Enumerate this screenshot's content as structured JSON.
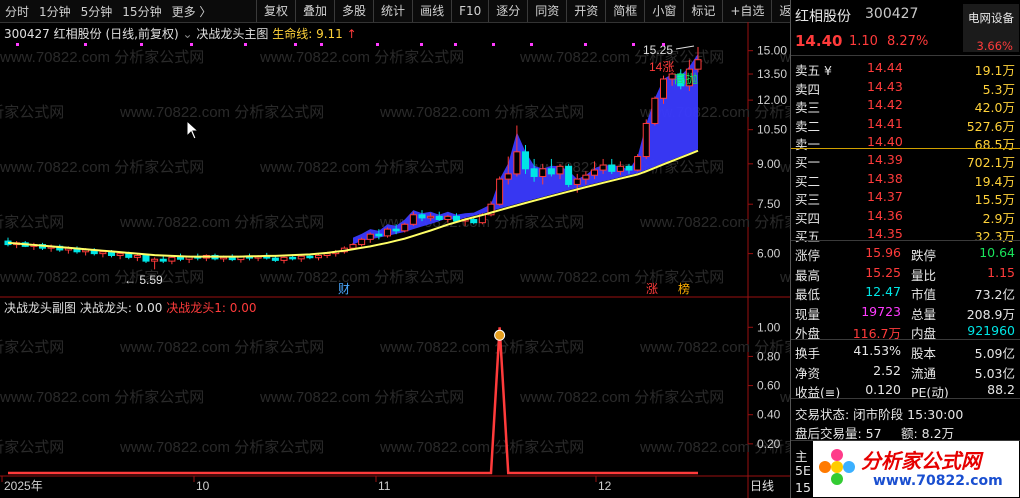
{
  "toolbar": {
    "period_items": [
      "分时",
      "1分钟",
      "5分钟",
      "15分钟",
      "更多 〉"
    ],
    "tools": [
      "复权",
      "叠加",
      "多股",
      "统计",
      "画线",
      "F10",
      "逐分",
      "同资",
      "开资",
      "简框",
      "小窗",
      "标记",
      "+自选",
      "返回"
    ]
  },
  "main_chart": {
    "code": "300427",
    "name": "红相股份",
    "mode": "(日线,前复权)",
    "formula": "决战龙头主图",
    "life_label": "生命线: 9.11",
    "life_arrow": "↑",
    "annotations": {
      "high_tag": "15.25",
      "low_tag": "5.59",
      "jump_tag": "14涨",
      "sell_tag": "高抛",
      "cai_tag": "财",
      "zhang_tag": "涨",
      "bang_tag": "榜"
    },
    "watermark": "www.70822.com 分析家公式网"
  },
  "sub_chart": {
    "formula": "决战龙头副图",
    "value_label": "决战龙头: 0.00",
    "value_label_red": "决战龙头1: 0.00"
  },
  "x_axis": {
    "labels": [
      "2025年",
      "10",
      "11",
      "12"
    ],
    "period_button": "日线"
  },
  "colors": {
    "up": "#ff3b3b",
    "down": "#00e6e6",
    "ma": "#ffff66",
    "band": "#3a3aff",
    "accent_red": "#ff3b3b"
  },
  "chart_data": [
    {
      "type": "candlestick",
      "title": "红相股份 (日线,前复权)",
      "y_ticks": [
        "15.00",
        "13.50",
        "12.00",
        "10.50",
        "9.00",
        "7.50",
        "6.00"
      ],
      "ylim": [
        5.0,
        15.6
      ],
      "y_scale": "log",
      "ohlc": [
        [
          6.35,
          6.45,
          6.2,
          6.25
        ],
        [
          6.25,
          6.35,
          6.15,
          6.3
        ],
        [
          6.3,
          6.35,
          6.18,
          6.2
        ],
        [
          6.2,
          6.3,
          6.1,
          6.25
        ],
        [
          6.25,
          6.3,
          6.1,
          6.15
        ],
        [
          6.15,
          6.25,
          6.05,
          6.2
        ],
        [
          6.2,
          6.25,
          6.05,
          6.1
        ],
        [
          6.1,
          6.2,
          6.0,
          6.15
        ],
        [
          6.15,
          6.2,
          6.0,
          6.05
        ],
        [
          6.05,
          6.15,
          5.95,
          6.1
        ],
        [
          6.1,
          6.15,
          5.95,
          6.0
        ],
        [
          6.0,
          6.1,
          5.9,
          6.05
        ],
        [
          6.05,
          6.1,
          5.9,
          5.95
        ],
        [
          5.95,
          6.05,
          5.85,
          6.0
        ],
        [
          6.0,
          6.05,
          5.85,
          5.9
        ],
        [
          5.9,
          6.0,
          5.8,
          5.95
        ],
        [
          5.95,
          6.0,
          5.75,
          5.8
        ],
        [
          5.8,
          5.9,
          5.59,
          5.85
        ],
        [
          5.85,
          5.95,
          5.75,
          5.8
        ],
        [
          5.8,
          5.95,
          5.72,
          5.9
        ],
        [
          5.9,
          6.0,
          5.8,
          5.85
        ],
        [
          5.85,
          5.95,
          5.75,
          5.92
        ],
        [
          5.92,
          6.0,
          5.82,
          5.88
        ],
        [
          5.88,
          5.98,
          5.8,
          5.95
        ],
        [
          5.95,
          6.0,
          5.82,
          5.86
        ],
        [
          5.86,
          5.95,
          5.78,
          5.9
        ],
        [
          5.9,
          5.98,
          5.8,
          5.84
        ],
        [
          5.84,
          5.95,
          5.76,
          5.92
        ],
        [
          5.92,
          6.0,
          5.82,
          5.88
        ],
        [
          5.88,
          5.96,
          5.8,
          5.93
        ],
        [
          5.93,
          6.02,
          5.84,
          5.88
        ],
        [
          5.88,
          5.96,
          5.78,
          5.82
        ],
        [
          5.82,
          5.92,
          5.74,
          5.9
        ],
        [
          5.9,
          5.98,
          5.82,
          5.86
        ],
        [
          5.86,
          5.95,
          5.78,
          5.93
        ],
        [
          5.93,
          6.0,
          5.85,
          5.89
        ],
        [
          5.89,
          5.98,
          5.82,
          5.95
        ],
        [
          5.95,
          6.05,
          5.88,
          6.0
        ],
        [
          6.0,
          6.1,
          5.92,
          6.05
        ],
        [
          6.05,
          6.2,
          6.0,
          6.15
        ],
        [
          6.15,
          6.3,
          6.1,
          6.25
        ],
        [
          6.25,
          6.45,
          6.2,
          6.4
        ],
        [
          6.4,
          6.6,
          6.3,
          6.55
        ],
        [
          6.55,
          6.7,
          6.4,
          6.5
        ],
        [
          6.5,
          6.75,
          6.45,
          6.7
        ],
        [
          6.7,
          6.85,
          6.55,
          6.65
        ],
        [
          6.65,
          6.9,
          6.6,
          6.85
        ],
        [
          6.85,
          7.25,
          6.8,
          7.15
        ],
        [
          7.15,
          7.3,
          6.95,
          7.05
        ],
        [
          7.05,
          7.2,
          6.95,
          7.1
        ],
        [
          7.1,
          7.25,
          6.95,
          7.0
        ],
        [
          7.0,
          7.15,
          6.9,
          7.1
        ],
        [
          7.1,
          7.2,
          6.9,
          6.95
        ],
        [
          6.95,
          7.05,
          6.8,
          7.0
        ],
        [
          7.0,
          7.1,
          6.85,
          6.9
        ],
        [
          6.9,
          7.2,
          6.85,
          7.15
        ],
        [
          7.15,
          7.6,
          7.1,
          7.5
        ],
        [
          7.5,
          8.5,
          7.45,
          8.4
        ],
        [
          8.4,
          9.3,
          8.2,
          8.6
        ],
        [
          8.6,
          10.7,
          8.5,
          9.5
        ],
        [
          9.5,
          9.8,
          8.6,
          8.8
        ],
        [
          8.8,
          9.2,
          8.3,
          8.5
        ],
        [
          8.5,
          9.0,
          8.2,
          8.8
        ],
        [
          8.8,
          9.2,
          8.5,
          8.6
        ],
        [
          8.6,
          9.0,
          8.4,
          8.9
        ],
        [
          8.9,
          9.0,
          8.1,
          8.2
        ],
        [
          8.2,
          8.6,
          7.9,
          8.4
        ],
        [
          8.4,
          8.7,
          8.2,
          8.55
        ],
        [
          8.55,
          9.1,
          8.4,
          8.75
        ],
        [
          8.75,
          9.2,
          8.6,
          8.95
        ],
        [
          8.95,
          9.2,
          8.6,
          8.7
        ],
        [
          8.7,
          9.1,
          8.55,
          8.9
        ],
        [
          8.9,
          9.0,
          8.6,
          8.75
        ],
        [
          8.75,
          9.4,
          8.7,
          9.3
        ],
        [
          9.3,
          11.0,
          9.2,
          10.8
        ],
        [
          10.8,
          12.2,
          10.7,
          12.1
        ],
        [
          12.1,
          13.4,
          11.8,
          13.2
        ],
        [
          13.2,
          13.6,
          12.8,
          13.5
        ],
        [
          13.5,
          13.8,
          12.6,
          12.8
        ],
        [
          12.8,
          14.4,
          12.5,
          13.8
        ],
        [
          13.8,
          15.25,
          13.6,
          14.4
        ]
      ],
      "ma": [
        6.3,
        6.28,
        6.26,
        6.24,
        6.22,
        6.2,
        6.18,
        6.16,
        6.14,
        6.12,
        6.1,
        6.08,
        6.06,
        6.04,
        6.02,
        6.0,
        5.98,
        5.96,
        5.95,
        5.94,
        5.93,
        5.92,
        5.92,
        5.92,
        5.92,
        5.92,
        5.92,
        5.92,
        5.93,
        5.93,
        5.94,
        5.94,
        5.95,
        5.96,
        5.97,
        5.98,
        6.0,
        6.02,
        6.05,
        6.08,
        6.12,
        6.16,
        6.2,
        6.25,
        6.3,
        6.36,
        6.42,
        6.5,
        6.58,
        6.66,
        6.75,
        6.84,
        6.92,
        7.0,
        7.07,
        7.14,
        7.22,
        7.3,
        7.38,
        7.46,
        7.54,
        7.62,
        7.7,
        7.78,
        7.86,
        7.94,
        8.02,
        8.1,
        8.18,
        8.26,
        8.34,
        8.42,
        8.5,
        8.58,
        8.7,
        8.84,
        8.98,
        9.12,
        9.26,
        9.4,
        9.55
      ]
    },
    {
      "type": "line",
      "title": "决战龙头副图",
      "y_ticks": [
        "1.00",
        "0.80",
        "0.60",
        "0.40",
        "0.20"
      ],
      "ylim": [
        0,
        1.05
      ],
      "values_note": "",
      "values": [
        0,
        0,
        0,
        0,
        0,
        0,
        0,
        0,
        0,
        0,
        0,
        0,
        0,
        0,
        0,
        0,
        0,
        0,
        0,
        0,
        0,
        0,
        0,
        0,
        0,
        0,
        0,
        0,
        0,
        0,
        0,
        0,
        0,
        0,
        0,
        0,
        0,
        0,
        0,
        0,
        0,
        0,
        0,
        0,
        0,
        0,
        0,
        0,
        0,
        0,
        0,
        0,
        0,
        0,
        0,
        0,
        0,
        1,
        0,
        0,
        0,
        0,
        0,
        0,
        0,
        0,
        0,
        0,
        0,
        0,
        0,
        0,
        0,
        0,
        0,
        0,
        0,
        0,
        0,
        0,
        0
      ]
    }
  ],
  "quote": {
    "name": "红相股份",
    "code": "300427",
    "tag": "电网设备",
    "price": "14.40",
    "change": "1.10",
    "pct": "8.27%",
    "tag_pct": "3.66%",
    "asks": [
      {
        "label": "卖五 ¥",
        "price": "14.44",
        "vol": "19.1万"
      },
      {
        "label": "卖四",
        "price": "14.43",
        "vol": "5.3万"
      },
      {
        "label": "卖三",
        "price": "14.42",
        "vol": "42.0万"
      },
      {
        "label": "卖二",
        "price": "14.41",
        "vol": "527.6万"
      },
      {
        "label": "卖一",
        "price": "14.40",
        "vol": "68.5万"
      }
    ],
    "bids": [
      {
        "label": "买一",
        "price": "14.39",
        "vol": "702.1万"
      },
      {
        "label": "买二",
        "price": "14.38",
        "vol": "19.4万"
      },
      {
        "label": "买三",
        "price": "14.37",
        "vol": "15.5万"
      },
      {
        "label": "买四",
        "price": "14.36",
        "vol": "2.9万"
      },
      {
        "label": "买五",
        "price": "14.35",
        "vol": "32.3万"
      }
    ],
    "stats1": [
      {
        "l1": "涨停",
        "v1": "15.96",
        "l2": "跌停",
        "v2": "10.64"
      },
      {
        "l1": "最高",
        "v1": "15.25",
        "l2": "量比",
        "v2": "1.15"
      },
      {
        "l1": "最低",
        "v1": "12.47",
        "l2": "市值",
        "v2": "73.2亿"
      },
      {
        "l1": "现量",
        "v1": "19723",
        "l2": "总量",
        "v2": "208.9万"
      },
      {
        "l1": "外盘",
        "v1": "116.7万",
        "l2": "内盘",
        "v2": "921960"
      }
    ],
    "stats2": [
      {
        "l1": "换手",
        "v1": "41.53%",
        "l2": "股本",
        "v2": "5.09亿"
      },
      {
        "l1": "净资",
        "v1": "2.52",
        "l2": "流通",
        "v2": "5.03亿"
      },
      {
        "l1": "收益(≡)",
        "v1": "0.120",
        "l2": "PE(动)",
        "v2": "88.2"
      }
    ],
    "trade_status": "交易状态: 闭市阶段 15:30:00",
    "after_hours": "盘后交易量: 57",
    "after_amount": "额: 8.2万",
    "bottom_rows": [
      "主",
      "5E",
      "15"
    ],
    "logo_text": "分析家公式网",
    "logo_url": "www.70822.com"
  }
}
